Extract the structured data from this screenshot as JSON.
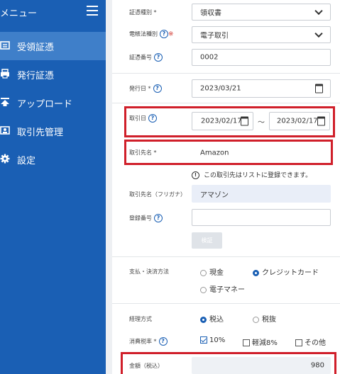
{
  "sidebar": {
    "title": "メニュー",
    "items": [
      {
        "label": "受領証憑",
        "icon": "receipt-icon",
        "active": true
      },
      {
        "label": "発行証憑",
        "icon": "print-icon",
        "active": false
      },
      {
        "label": "アップロード",
        "icon": "upload-icon",
        "active": false
      },
      {
        "label": "取引先管理",
        "icon": "contact-card-icon",
        "active": false
      },
      {
        "label": "設定",
        "icon": "gear-icon",
        "active": false
      }
    ]
  },
  "form": {
    "doc_type": {
      "label": "証憑種別",
      "required_mark": "*",
      "value": "領収書"
    },
    "e_law_type": {
      "label": "電帳法種別",
      "required_mark": "※",
      "value": "電子取引"
    },
    "doc_number": {
      "label": "証憑番号",
      "value": "0002"
    },
    "issue_date": {
      "label": "発行日",
      "required_mark": "*",
      "value": "2023/03/21"
    },
    "trade_date": {
      "label": "取引日",
      "from": "2023/02/17",
      "separator": "〜",
      "to": "2023/02/17"
    },
    "partner_name": {
      "label": "取引先名",
      "required_mark": "*",
      "value": "Amazon"
    },
    "partner_notice": "この取引先はリストに登録できます。",
    "partner_kana": {
      "label": "取引先名（フリガナ）",
      "value": "アマゾン"
    },
    "registration_number": {
      "label": "登録番号",
      "value": ""
    },
    "verify_button": "検証",
    "payment_method": {
      "label": "支払・決済方法",
      "options": [
        {
          "label": "現金",
          "selected": false
        },
        {
          "label": "クレジットカード",
          "selected": true
        },
        {
          "label": "電子マネー",
          "selected": false
        }
      ]
    },
    "accounting_method": {
      "label": "経理方式",
      "options": [
        {
          "label": "税込",
          "selected": true
        },
        {
          "label": "税抜",
          "selected": false
        }
      ]
    },
    "tax_rate": {
      "label": "消費税率",
      "required_mark": "*",
      "options": [
        {
          "label": "10%",
          "checked": true
        },
        {
          "label": "軽減8%",
          "checked": false
        },
        {
          "label": "その他",
          "checked": false
        }
      ]
    },
    "amount": {
      "label": "金額（税込）",
      "value": "980"
    }
  },
  "colors": {
    "sidebar": "#1a5fb4",
    "sidebar_active": "#3f7fc9",
    "highlight_red": "#d01f2a",
    "accent": "#1a5fb4"
  }
}
